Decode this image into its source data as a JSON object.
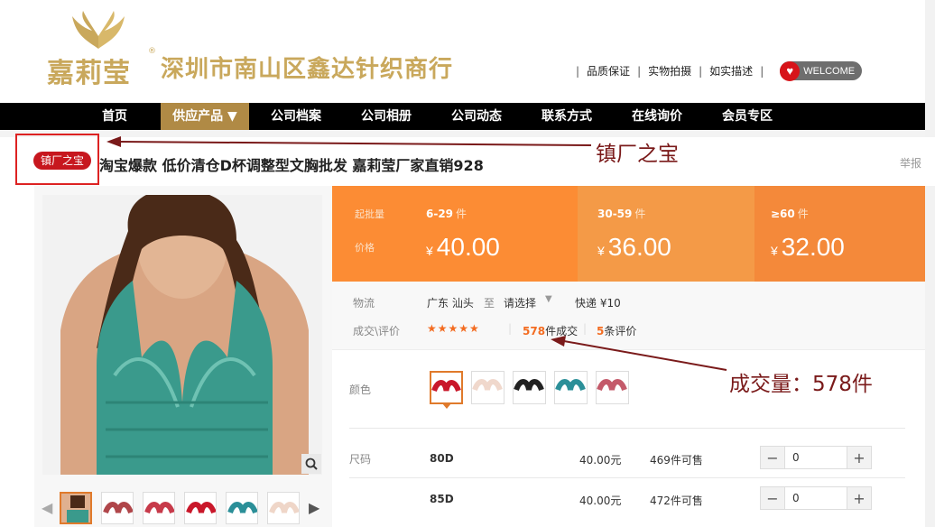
{
  "header": {
    "logo_text": "嘉莉莹",
    "logo_reg": "®",
    "company_name": "深圳市南山区鑫达针织商行",
    "links": [
      "品质保证",
      "实物拍摄",
      "如实描述"
    ],
    "welcome": "WELCOME"
  },
  "nav": {
    "items": [
      "首页",
      "供应产品 ▼",
      "公司档案",
      "公司相册",
      "公司动态",
      "联系方式",
      "在线询价",
      "会员专区"
    ],
    "active_index": 1
  },
  "product": {
    "badge": "镇厂之宝",
    "title": "淘宝爆款 低价清仓D杯调整型文胸批发 嘉莉莹厂家直销928",
    "report": "举报"
  },
  "annotations": {
    "badge_note": "镇厂之宝",
    "sales_note": "成交量：578件"
  },
  "pricing": {
    "min_label": "起批量",
    "price_label": "价格",
    "currency": "¥",
    "tiers": [
      {
        "range": "6-29",
        "unit": "件",
        "price": "40.00"
      },
      {
        "range": "30-59",
        "unit": "件",
        "price": "36.00"
      },
      {
        "range": "≥60",
        "unit": "件",
        "price": "32.00"
      }
    ]
  },
  "logistics": {
    "label": "物流",
    "origin": "广东 汕头",
    "to": "至",
    "dest": "请选择",
    "shipping": "快递 ¥10"
  },
  "reviews": {
    "label": "成交\\评价",
    "stars": "★★★★★",
    "sold_count": "578",
    "sold_suffix": "件成交",
    "review_count": "5",
    "review_suffix": "条评价"
  },
  "colors": {
    "label": "颜色",
    "swatches": [
      "red",
      "nude",
      "black",
      "teal",
      "rose"
    ]
  },
  "sizes": {
    "label": "尺码",
    "rows": [
      {
        "size": "80D",
        "price": "40.00元",
        "stock": "469件可售",
        "qty": "0"
      },
      {
        "size": "85D",
        "price": "40.00元",
        "stock": "472件可售",
        "qty": "0"
      }
    ]
  },
  "icons": {
    "zoom": "magnifier-icon",
    "prev": "chevron-left-icon",
    "next": "chevron-right-icon",
    "heart": "heart-icon"
  },
  "theme": {
    "gold": "#c9a85c",
    "orange": "#fc8c34",
    "red": "#c7171e"
  }
}
